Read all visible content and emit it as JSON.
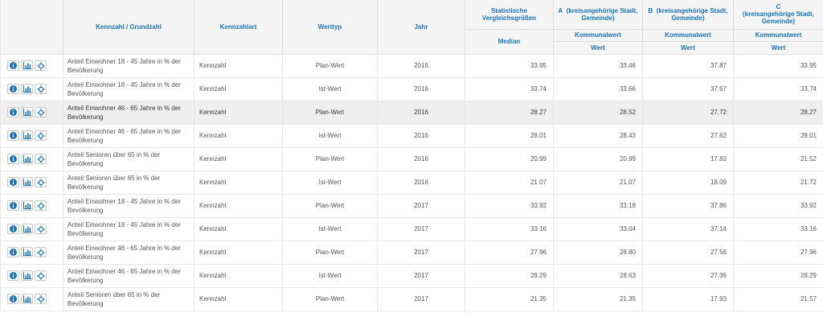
{
  "header": {
    "kennzahl": "Kennzahl / Grundzahl",
    "kennzahlart": "Kennzahlart",
    "werttyp": "Werttyp",
    "jahr": "Jahr",
    "statistische": "Statistische Vergleichsgrößen",
    "median": "Median",
    "colA_letter": "A",
    "colA_label": "(kreisangehörige Stadt, Gemeinde)",
    "colB_letter": "B",
    "colB_label": "(kreisangehörige Stadt, Gemeinde)",
    "colC_letter": "C",
    "colC_label": "(kreisangehörige Stadt, Gemeinde)",
    "kommunalwert": "Kommunalwert",
    "wert": "Wert"
  },
  "icons": [
    "info-icon",
    "chart-icon",
    "locate-icon"
  ],
  "colors": {
    "header_text": "#1a73b8",
    "icon_blue": "#1a73b8",
    "selected_row": "#efefef"
  },
  "rows": [
    {
      "name": "Anteil Einwohner 18 - 45 Jahre in % der Bevölkerung",
      "art": "Kennzahl",
      "typ": "Plan-Wert",
      "jahr": "2016",
      "median": "33.95",
      "a": "33.46",
      "b": "37.87",
      "c": "33.95"
    },
    {
      "name": "Anteil Einwohner 18 - 45 Jahre in % der Bevölkerung",
      "art": "Kennzahl",
      "typ": "Ist-Wert",
      "jahr": "2016",
      "median": "33.74",
      "a": "33.66",
      "b": "37.67",
      "c": "33.74"
    },
    {
      "name": "Anteil Einwohner 46 - 65 Jahre in % der Bevölkerung",
      "art": "Kennzahl",
      "typ": "Plan-Wert",
      "jahr": "2016",
      "median": "28.27",
      "a": "28.52",
      "b": "27.72",
      "c": "28.27",
      "selected": true
    },
    {
      "name": "Anteil Einwohner 46 - 65 Jahre in % der Bevölkerung",
      "art": "Kennzahl",
      "typ": "Ist-Wert",
      "jahr": "2016",
      "median": "28.01",
      "a": "28.43",
      "b": "27.62",
      "c": "28.01"
    },
    {
      "name": "Anteil Senioren über 65 in % der Bevölkerung",
      "art": "Kennzahl",
      "typ": "Plan-Wert",
      "jahr": "2016",
      "median": "20.99",
      "a": "20.99",
      "b": "17.83",
      "c": "21.52"
    },
    {
      "name": "Anteil Senioren über 65 in % der Bevölkerung",
      "art": "Kennzahl",
      "typ": "Ist-Wert",
      "jahr": "2016",
      "median": "21.07",
      "a": "21.07",
      "b": "18.09",
      "c": "21.72"
    },
    {
      "name": "Anteil Einwohner 18 - 45 Jahre in % der Bevölkerung",
      "art": "Kennzahl",
      "typ": "Plan-Wert",
      "jahr": "2017",
      "median": "33.92",
      "a": "33.18",
      "b": "37.86",
      "c": "33.92"
    },
    {
      "name": "Anteil Einwohner 18 - 45 Jahre in % der Bevölkerung",
      "art": "Kennzahl",
      "typ": "Ist-Wert",
      "jahr": "2017",
      "median": "33.16",
      "a": "33.04",
      "b": "37.14",
      "c": "33.16"
    },
    {
      "name": "Anteil Einwohner 46 - 65 Jahre in % der Bevölkerung",
      "art": "Kennzahl",
      "typ": "Plan-Wert",
      "jahr": "2017",
      "median": "27.96",
      "a": "28.80",
      "b": "27.56",
      "c": "27.96"
    },
    {
      "name": "Anteil Einwohner 46 - 65 Jahre in % der Bevölkerung",
      "art": "Kennzahl",
      "typ": "Ist-Wert",
      "jahr": "2017",
      "median": "28.29",
      "a": "28.63",
      "b": "27.36",
      "c": "28.29"
    },
    {
      "name": "Anteil Senioren über 65 in % der Bevölkerung",
      "art": "Kennzahl",
      "typ": "Plan-Wert",
      "jahr": "2017",
      "median": "21.35",
      "a": "21.35",
      "b": "17.93",
      "c": "21.57"
    }
  ]
}
